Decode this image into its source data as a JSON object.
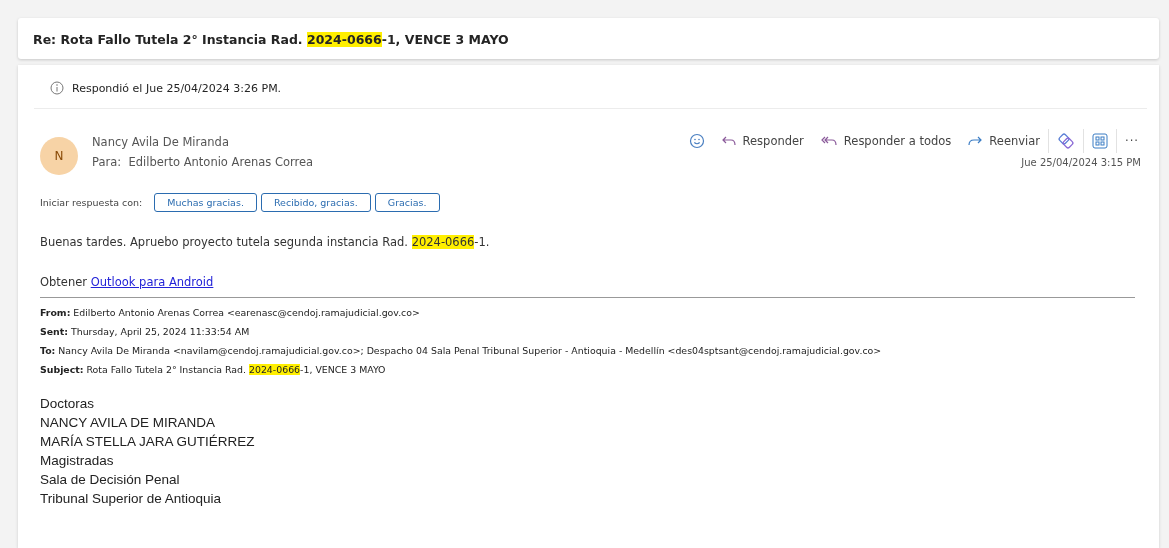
{
  "subject": [
    {
      "text": "Re: Rota Fallo Tutela 2° Instancia Rad. ",
      "highlight": false
    },
    {
      "text": "2024-0666",
      "highlight": true
    },
    {
      "text": "-1, VENCE 3 MAYO",
      "highlight": false
    }
  ],
  "info": "Respondió el Jue 25/04/2024 3:26 PM.",
  "message": {
    "avatar": "N",
    "sender": "Nancy Avila De Miranda",
    "to_label": "Para:",
    "to": "Edilberto Antonio Arenas Correa",
    "date": "Jue 25/04/2024 3:15 PM",
    "actions": [
      {
        "kind": "emoji"
      },
      {
        "kind": "reply",
        "label": "Responder"
      },
      {
        "kind": "reply_all",
        "label": "Responder a todos"
      },
      {
        "kind": "forward",
        "label": "Reenviar"
      },
      {
        "kind": "loop"
      },
      {
        "kind": "apps"
      },
      {
        "kind": "more",
        "label": "···"
      }
    ]
  },
  "quick_reply": {
    "label": "Iniciar respuesta con:",
    "options": [
      "Muchas gracias.",
      "Recibido, gracias.",
      "Gracias."
    ]
  },
  "body": [
    {
      "text": "Buenas tardes. Apruebo proyecto tutela segunda instancia Rad. ",
      "highlight": false
    },
    {
      "text": "2024-0666",
      "highlight": true
    },
    {
      "text": "-1.",
      "highlight": false
    }
  ],
  "signature": {
    "prefix": "Obtener",
    "link": "Outlook para Android"
  },
  "quoted_header": [
    [
      {
        "text": "**From:** Edilberto Antonio Arenas Correa <earenasc@cendoj.ramajudicial.gov.co>",
        "highlight": false
      }
    ],
    [
      {
        "text": "**Sent:** Thursday, April 25, 2024 11:33:54 AM",
        "highlight": false
      }
    ],
    [
      {
        "text": "**To:** Nancy Avila De Miranda <navilam@cendoj.ramajudicial.gov.co>; Despacho 04 Sala Penal Tribunal Superior - Antioquia - Medellín <des04sptsant@cendoj.ramajudicial.gov.co>",
        "highlight": false
      }
    ],
    [
      {
        "text": "**Subject:** Rota Fallo Tutela 2° Instancia Rad. ",
        "highlight": false
      },
      {
        "text": "2024-0666",
        "highlight": true
      },
      {
        "text": "-1, VENCE 3 MAYO",
        "highlight": false
      }
    ]
  ],
  "quoted_body": [
    "Doctoras",
    "NANCY AVILA DE MIRANDA",
    "MARÍA STELLA JARA GUTIÉRREZ",
    "Magistradas",
    "Sala de Decisión Penal",
    "Tribunal Superior de Antioquia"
  ]
}
